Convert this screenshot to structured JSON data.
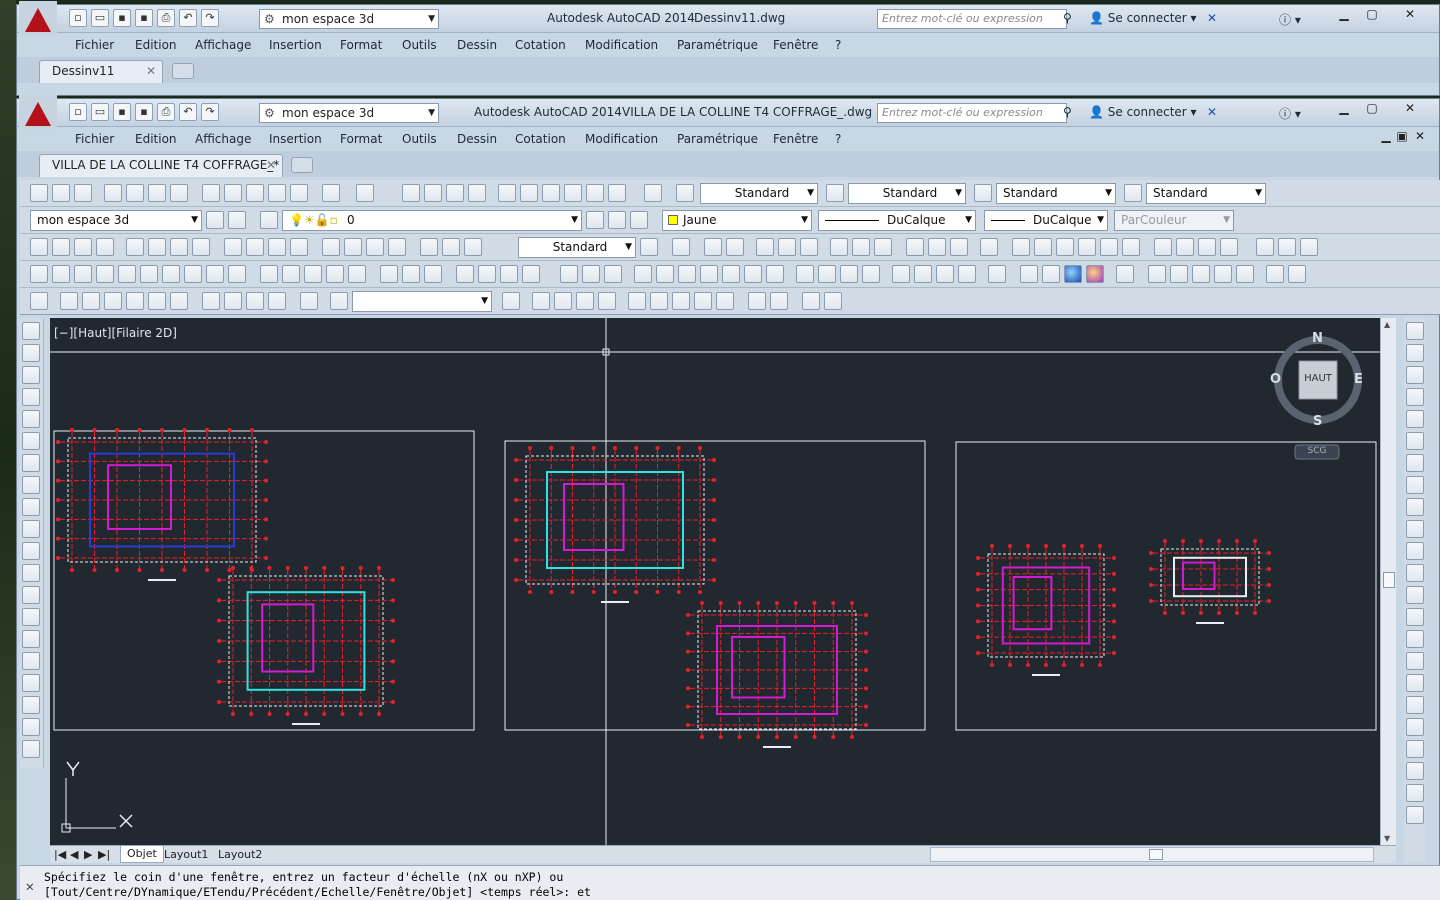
{
  "back_window": {
    "workspace": "mon espace 3d",
    "app_title": "Autodesk AutoCAD 2014",
    "file_title": "Dessinv11.dwg",
    "search_placeholder": "Entrez mot-clé ou expression",
    "signin": "Se connecter",
    "doc_tab": "Dessinv11"
  },
  "front_window": {
    "workspace": "mon espace 3d",
    "app_title": "Autodesk AutoCAD 2014",
    "file_title": "VILLA DE LA COLLINE T4 COFFRAGE_.dwg",
    "search_placeholder": "Entrez mot-clé ou expression",
    "signin": "Se connecter",
    "doc_tab": "VILLA DE LA COLLINE T4 COFFRAGE_*"
  },
  "menu": [
    "Fichier",
    "Edition",
    "Affichage",
    "Insertion",
    "Format",
    "Outils",
    "Dessin",
    "Cotation",
    "Modification",
    "Paramétrique",
    "Fenêtre",
    "?"
  ],
  "styles": {
    "text_style": "Standard",
    "dim_style": "Standard",
    "table_style": "Standard",
    "mleader_style": "Standard"
  },
  "layers": {
    "workspace_combo": "mon espace 3d",
    "current_layer": "0",
    "color": "Jaune",
    "linetype": "DuCalque",
    "lineweight": "DuCalque",
    "plotstyle": "ParCouleur",
    "dim_combo": "Standard"
  },
  "viewport": {
    "label": "[−][Haut][Filaire 2D]",
    "compass_n": "N",
    "compass_s": "S",
    "compass_e": "E",
    "compass_o": "O",
    "viewcube": "HAUT",
    "ucs_button": "SCG",
    "axis_y": "Y",
    "axis_x": "X"
  },
  "layout_tabs": [
    "Objet",
    "Layout1",
    "Layout2"
  ],
  "command": {
    "line1": "Spécifiez le coin d'une fenêtre, entrez un facteur d'échelle (nX ou nXP) ou",
    "line2": "[Tout/Centre/DYnamique/ETendu/Précédent/Echelle/Fenêtre/Objet] <temps réel>: et"
  },
  "colors": {
    "ui_bg": "#c9d6e4",
    "viewport_bg": "#212830",
    "plan_red": "#e8202a",
    "plan_cyan": "#2fe3e3",
    "plan_magenta": "#d21bd2",
    "plan_blue": "#2a3bd8"
  }
}
